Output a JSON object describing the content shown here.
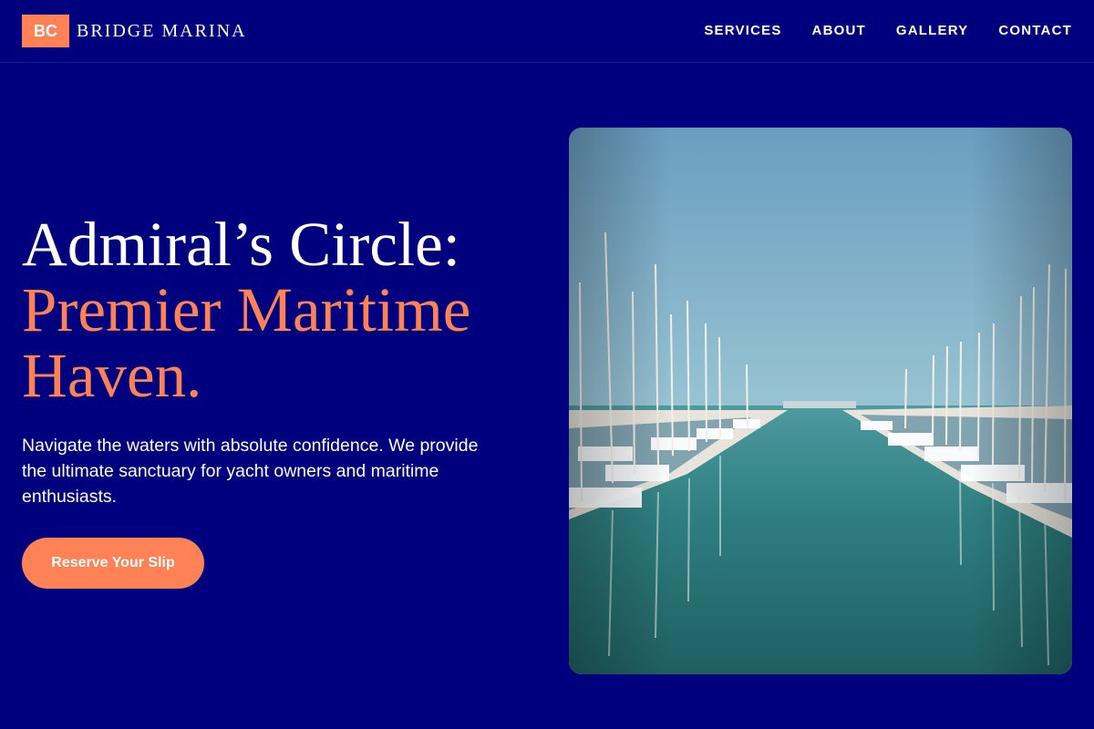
{
  "brand": {
    "logo_mark": "BC",
    "name": "BRIDGE MARINA"
  },
  "nav": {
    "items": [
      {
        "label": "SERVICES"
      },
      {
        "label": "ABOUT"
      },
      {
        "label": "GALLERY"
      },
      {
        "label": "CONTACT"
      }
    ]
  },
  "hero": {
    "title_line1": "Admiral’s Circle:",
    "title_line2": "Premier Maritime Haven.",
    "description": "Navigate the waters with absolute confidence. We provide the ultimate sanctuary for yacht owners and maritime enthusiasts.",
    "cta_label": "Reserve Your Slip",
    "image_alt": "Marina with rows of sailboats reflected in calm water"
  },
  "colors": {
    "background": "#00007f",
    "accent": "#ff8256",
    "text": "#ffffff"
  }
}
